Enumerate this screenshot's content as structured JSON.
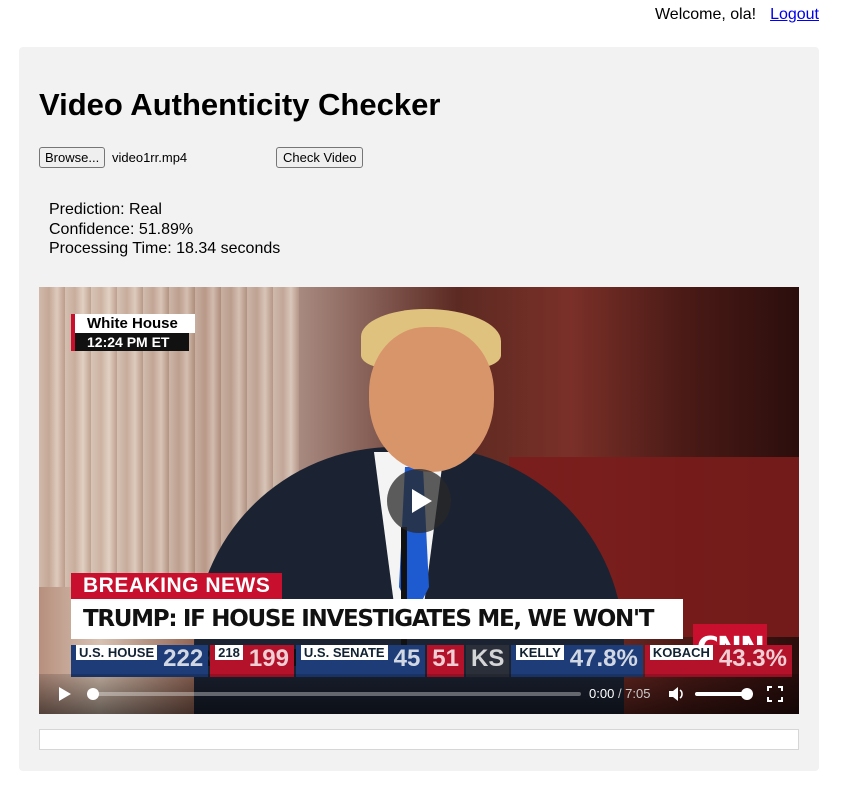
{
  "header": {
    "welcome_text": "Welcome, ola!",
    "logout_label": "Logout"
  },
  "main": {
    "title": "Video Authenticity Checker",
    "file_input": {
      "browse_label": "Browse...",
      "filename": "video1rr.mp4"
    },
    "check_button_label": "Check Video",
    "result": {
      "prediction": "Prediction: Real",
      "confidence": "Confidence: 51.89%",
      "processing_time": "Processing Time: 18.34 seconds"
    }
  },
  "video": {
    "overlay": {
      "location_label": "White House",
      "time_label": "12:24 PM ET",
      "breaking_label": "BREAKING NEWS",
      "headline": "TRUMP: IF HOUSE INVESTIGATES ME, WE WON'T COLLABORATE ON DEALS",
      "network_logo": "CNN",
      "ticker": [
        {
          "label": "U.S. HOUSE",
          "value": "222"
        },
        {
          "label": "218",
          "value": "199"
        },
        {
          "label": "U.S. SENATE",
          "value": "45"
        },
        {
          "label": "",
          "value": "51"
        },
        {
          "label": "KS",
          "value": ""
        },
        {
          "label": "KELLY",
          "value": "47.8%"
        },
        {
          "label": "KOBACH",
          "value": "43.3%"
        }
      ]
    },
    "controls": {
      "current_time": "0:00",
      "duration": "/ 7:05",
      "progress": 0.0,
      "volume": 1.0
    }
  },
  "colors": {
    "panel_bg": "#f2f2f2",
    "link": "#0000ee",
    "cnn_red": "#c8102e"
  }
}
